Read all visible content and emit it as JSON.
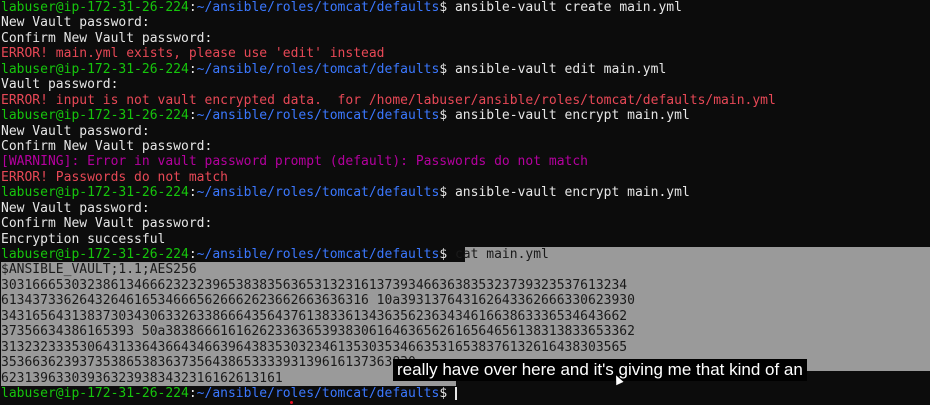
{
  "terminal": {
    "prompt_user": "labuser@ip-172-31-26-224",
    "prompt_path": "~/ansible/roles/tomcat/defaults",
    "prompt_dollar": "$",
    "lines": [
      {
        "kind": "prompt",
        "cmd": " ansible-vault create main.yml"
      },
      {
        "kind": "text",
        "text": "New Vault password:"
      },
      {
        "kind": "text",
        "text": "Confirm New Vault password:"
      },
      {
        "kind": "error",
        "text": "ERROR! main.yml exists, please use 'edit' instead"
      },
      {
        "kind": "prompt",
        "cmd": " ansible-vault edit main.yml"
      },
      {
        "kind": "text",
        "text": "Vault password:"
      },
      {
        "kind": "error",
        "text": "ERROR! input is not vault encrypted data.  for /home/labuser/ansible/roles/tomcat/defaults/main.yml"
      },
      {
        "kind": "prompt",
        "cmd": " ansible-vault encrypt main.yml"
      },
      {
        "kind": "text",
        "text": "New Vault password:"
      },
      {
        "kind": "text",
        "text": "Confirm New Vault password:"
      },
      {
        "kind": "warning",
        "text": "[WARNING]: Error in vault password prompt (default): Passwords do not match"
      },
      {
        "kind": "error",
        "text": "ERROR! Passwords do not match"
      },
      {
        "kind": "prompt",
        "cmd": " ansible-vault encrypt main.yml"
      },
      {
        "kind": "text",
        "text": "New Vault password:"
      },
      {
        "kind": "text",
        "text": "Confirm New Vault password:"
      },
      {
        "kind": "text",
        "text": "Encryption successful"
      },
      {
        "kind": "prompt",
        "cmd": " cat main.yml",
        "selected": true
      },
      {
        "kind": "sel",
        "text": "$ANSIBLE_VAULT;1.1;AES256"
      },
      {
        "kind": "sel",
        "text": "30316665303238613466623232396538383563653132316137393466363835323739323537613234"
      },
      {
        "kind": "sel",
        "text": "61343733626432646165346665626662623662663636316 10a393137643162643362666330623930"
      },
      {
        "kind": "sel",
        "text": "34316564313837303430633263386664356437613833613436356236343461663863336534643662"
      },
      {
        "kind": "sel",
        "text": "37356634386165393 50a383866616162623363653938306164636562616564656138313833653362"
      },
      {
        "kind": "sel",
        "text": "31323233353064313364366434663964383530323461353035346635316538376132616438303565"
      },
      {
        "kind": "sel",
        "text": "35366362393735386538363735643865333393139616137363830"
      },
      {
        "kind": "sel",
        "text": "623139633039363239383432316162613161"
      },
      {
        "kind": "prompt",
        "cmd": " ",
        "cursor": true
      }
    ]
  },
  "caption": {
    "text": "really have over here and it's giving me that kind of an"
  }
}
